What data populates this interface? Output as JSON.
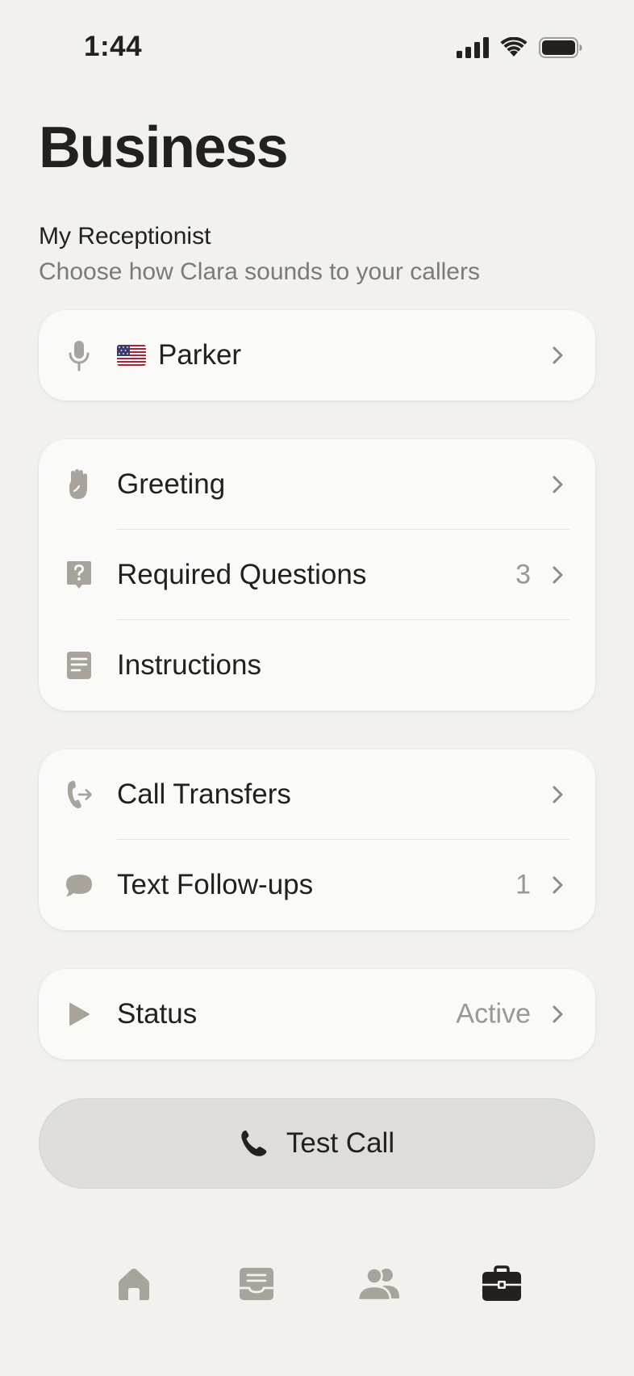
{
  "status_bar": {
    "time": "1:44"
  },
  "page": {
    "title": "Business"
  },
  "receptionist": {
    "title": "My Receptionist",
    "subtitle": "Choose how Clara sounds to your callers",
    "voice_name": "Parker"
  },
  "settings": {
    "greeting": {
      "label": "Greeting"
    },
    "required_questions": {
      "label": "Required Questions",
      "count": "3"
    },
    "instructions": {
      "label": "Instructions"
    }
  },
  "communications": {
    "call_transfers": {
      "label": "Call Transfers"
    },
    "text_followups": {
      "label": "Text Follow-ups",
      "count": "1"
    }
  },
  "status": {
    "label": "Status",
    "value": "Active"
  },
  "test_call": {
    "label": "Test Call"
  },
  "tabs": [
    {
      "icon": "home-icon",
      "active": false
    },
    {
      "icon": "inbox-icon",
      "active": false
    },
    {
      "icon": "contacts-icon",
      "active": false
    },
    {
      "icon": "briefcase-icon",
      "active": true
    }
  ],
  "colors": {
    "background": "#f2f1ee",
    "card": "#fafaf9",
    "text": "#23211e",
    "muted": "#9b9892",
    "icon": "#a8a49c",
    "button": "#dedddb"
  }
}
